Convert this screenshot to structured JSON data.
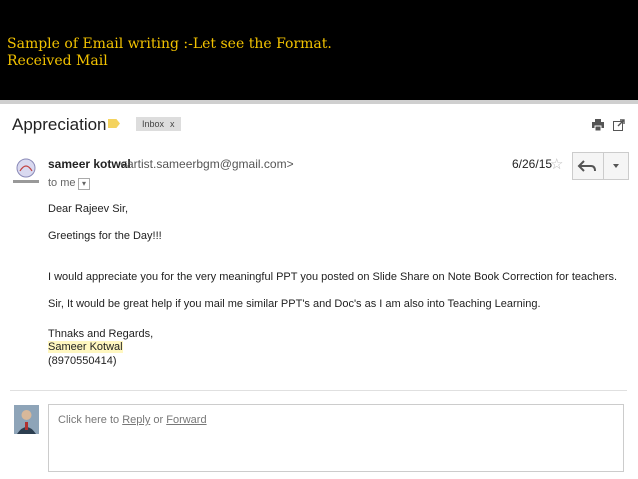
{
  "banner": {
    "line1": "Sample of Email writing :-Let see the Format.",
    "line2": "Received Mail",
    "text_color": "#f2c200"
  },
  "email": {
    "subject": "Appreciation",
    "label": "Inbox",
    "label_close": "x",
    "sender_name": "sameer kotwal",
    "sender_email": "<artist.sameerbgm@gmail.com>",
    "to": "to me",
    "date": "6/26/15",
    "body": [
      "Dear Rajeev Sir,",
      "Greetings for the Day!!!",
      "I would appreciate you for the very meaningful PPT you posted on Slide Share on Note Book Correction for teachers.",
      "Sir, It would be great help if you mail me similar PPT's and Doc's as I am also into Teaching Learning.",
      "Thnaks and Regards,",
      "Sameer Kotwal",
      "(8970550414)"
    ]
  },
  "reply": {
    "prefix": "Click here to ",
    "reply_link": "Reply",
    "middle": " or ",
    "forward_link": "Forward"
  },
  "icons": {
    "print": "print-icon",
    "popout": "new-window-icon",
    "star": "star-icon",
    "reply": "reply-icon",
    "more": "chevron-down-icon"
  }
}
